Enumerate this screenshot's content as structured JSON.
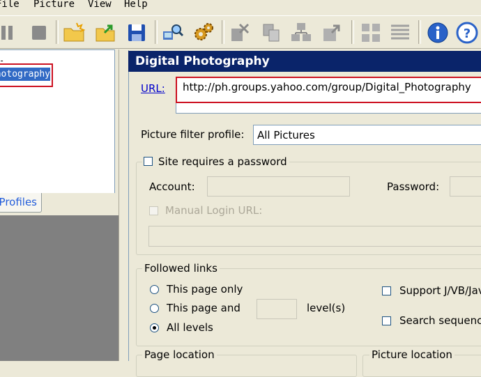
{
  "menu": {
    "file": "File",
    "picture": "Picture",
    "view": "View",
    "help": "Help"
  },
  "tree": {
    "root_fragment": "-",
    "selected_item": "Digital Photography"
  },
  "tabs": {
    "profiles": "Profiles"
  },
  "panel": {
    "title": "Digital Photography",
    "url_label": "URL:",
    "url_value": "http://ph.groups.yahoo.com/group/Digital_Photography",
    "filter_label": "Picture filter profile:",
    "filter_value": "All Pictures",
    "password": {
      "checkbox_label": "Site requires a password",
      "account_label": "Account:",
      "password_label": "Password:",
      "manual_login_label": "Manual Login URL:"
    },
    "followed_links": {
      "title": "Followed links",
      "option_page_only": "This page only",
      "option_page_and": "This page and",
      "levels_suffix": "level(s)",
      "option_all_levels": "All levels",
      "support_label": "Support J/VB/JavaScript",
      "search_label": "Search sequence"
    },
    "page_location_label": "Page location",
    "picture_location_label": "Picture location"
  },
  "colors": {
    "title_bar": "#0a246a",
    "highlight_red": "#cc1020",
    "selection": "#316ac5"
  }
}
